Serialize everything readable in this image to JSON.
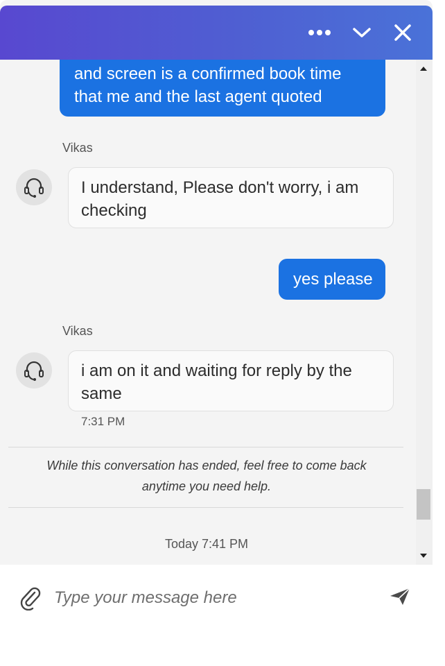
{
  "header": {
    "more_icon": "ellipsis-icon",
    "minimize_icon": "chevron-down-icon",
    "close_icon": "close-icon",
    "gradient": [
      "#5848d0",
      "#4a72d8"
    ]
  },
  "messages": [
    {
      "from": "user",
      "lines": [
        "and screen is a confirmed book time",
        "that me and the last agent quoted"
      ]
    },
    {
      "from": "agent",
      "sender": "Vikas",
      "lines": [
        "I understand, Please don't worry, i am",
        "checking"
      ]
    },
    {
      "from": "user",
      "lines": [
        "yes please"
      ]
    },
    {
      "from": "agent",
      "sender": "Vikas",
      "lines": [
        "i am on it and waiting for reply by the",
        "same"
      ],
      "time": "7:31 PM"
    }
  ],
  "conversation_end": {
    "line1": "While this conversation has ended, feel free to come back",
    "line2": "anytime you need help."
  },
  "day_stamp": "Today  7:41 PM",
  "composer": {
    "placeholder": "Type your message here",
    "value": "",
    "attach_icon": "paperclip-icon",
    "send_icon": "send-icon"
  },
  "colors": {
    "user_bubble": "#1b72e2",
    "agent_bubble": "#fafafa",
    "background": "#f4f4f4"
  }
}
